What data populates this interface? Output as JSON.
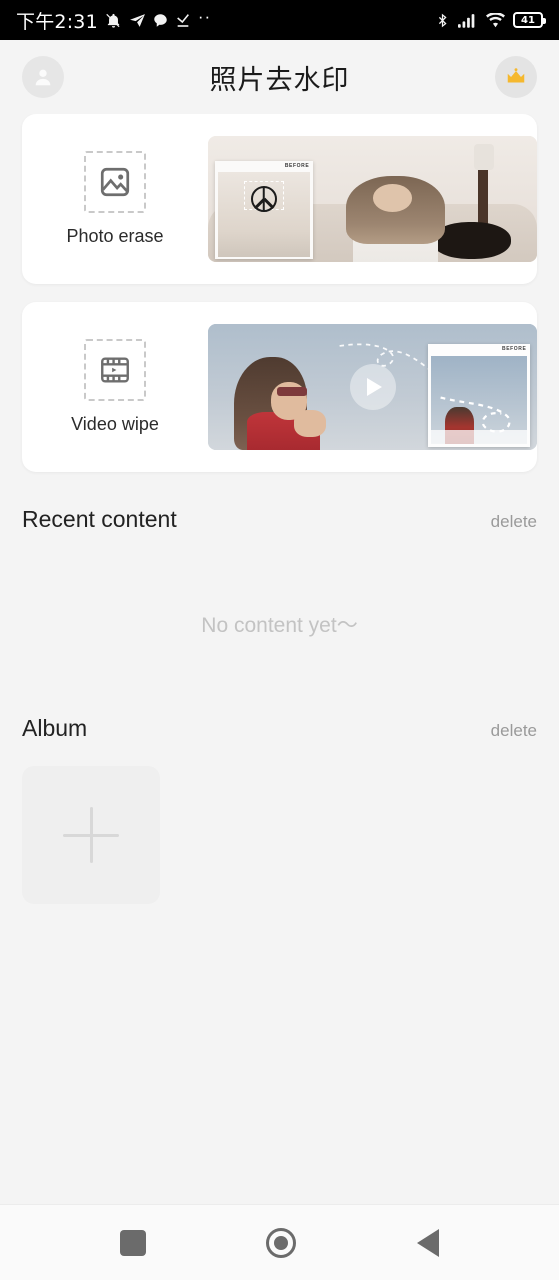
{
  "status_bar": {
    "clock": "下午2:31",
    "battery_percent": "41",
    "icons_left": [
      "bell-muted-icon",
      "telegram-send-icon",
      "speech-bubble-icon",
      "check-underline-icon",
      "more-dots-icon"
    ],
    "icons_right": [
      "bluetooth-icon",
      "cellular-signal-icon",
      "wifi-icon",
      "battery-icon"
    ],
    "more_dots": "··"
  },
  "header": {
    "title": "照片去水印",
    "avatar_icon": "user-avatar-icon",
    "premium_icon": "crown-icon"
  },
  "tools": [
    {
      "label": "Photo erase",
      "icon": "image-dashed-icon",
      "preview_badge": "BEFORE",
      "preview_name": "photo-before-after-preview"
    },
    {
      "label": "Video wipe",
      "icon": "film-play-dashed-icon",
      "preview_badge": "BEFORE",
      "preview_name": "video-before-after-preview",
      "play_icon": "play-icon"
    }
  ],
  "recent": {
    "title": "Recent content",
    "action": "delete",
    "empty_text": "No content yet〜"
  },
  "album": {
    "title": "Album",
    "action": "delete",
    "add_icon": "plus-icon"
  },
  "navbar": {
    "recents": "square-recents-icon",
    "home": "circle-home-icon",
    "back": "triangle-back-icon"
  },
  "colors": {
    "background": "#f4f4f4",
    "card": "#ffffff",
    "crown": "#f5b82e",
    "muted_text": "#9a9a9a",
    "empty_text": "#c3c3c3",
    "nav_icon": "#6b6b6b"
  }
}
